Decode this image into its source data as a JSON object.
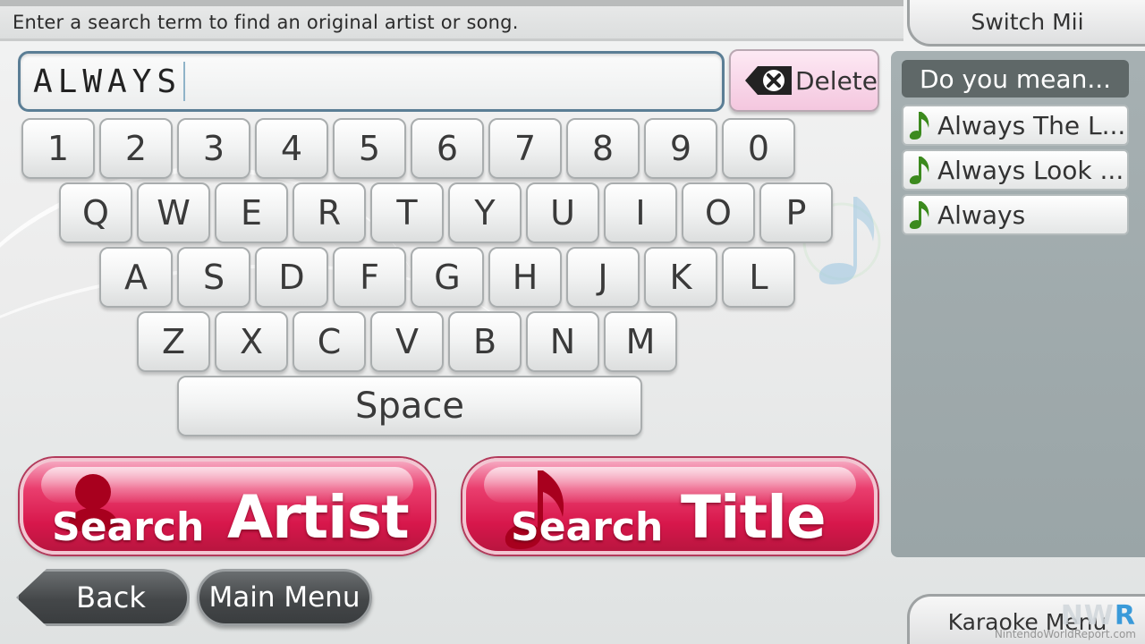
{
  "header": {
    "instruction": "Enter a search term to find an original artist or song."
  },
  "switch_mii": {
    "label": "Switch Mii"
  },
  "karaoke_menu": {
    "label": "Karaoke Menu"
  },
  "search": {
    "value": "ALWAYS"
  },
  "delete": {
    "label": "Delete"
  },
  "keyboard": {
    "row1": [
      "1",
      "2",
      "3",
      "4",
      "5",
      "6",
      "7",
      "8",
      "9",
      "0"
    ],
    "row2": [
      "Q",
      "W",
      "E",
      "R",
      "T",
      "Y",
      "U",
      "I",
      "O",
      "P"
    ],
    "row3": [
      "A",
      "S",
      "D",
      "F",
      "G",
      "H",
      "J",
      "K",
      "L"
    ],
    "row4": [
      "Z",
      "X",
      "C",
      "V",
      "B",
      "N",
      "M"
    ],
    "space": "Space"
  },
  "search_artist": {
    "small": "Search",
    "large": "Artist"
  },
  "search_title": {
    "small": "Search",
    "large": "Title"
  },
  "nav": {
    "back": "Back",
    "main_menu": "Main Menu"
  },
  "suggestions": {
    "title": "Do you mean...",
    "items": [
      "Always The L...",
      "Always Look ...",
      "Always"
    ]
  },
  "watermark": {
    "logo_a": "NW",
    "logo_b": "R",
    "site": "NintendoWorldReport.com"
  },
  "colors": {
    "accent_pink": "#d7174b",
    "field_border": "#5b7e95",
    "panel": "#a6b0b2",
    "note_green": "#3c8a1e"
  }
}
